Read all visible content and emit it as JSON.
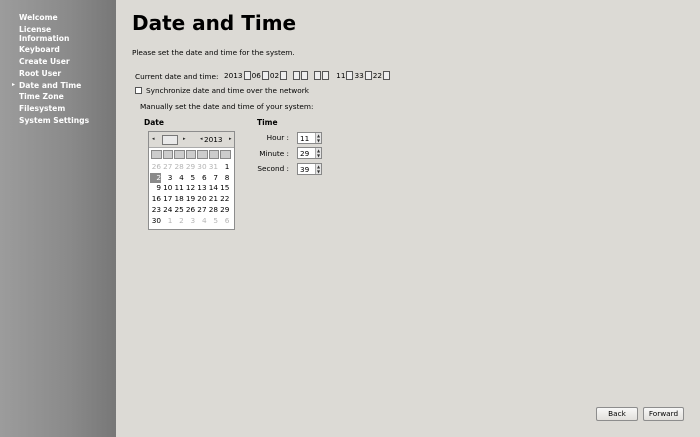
{
  "sidebar": {
    "items": [
      {
        "label": "Welcome"
      },
      {
        "label": "License"
      },
      {
        "label": "Information"
      },
      {
        "label": "Keyboard"
      },
      {
        "label": "Create User"
      },
      {
        "label": "Root User"
      },
      {
        "label": "Date and Time"
      },
      {
        "label": "Time Zone"
      },
      {
        "label": "Filesystem"
      },
      {
        "label": "System Settings"
      }
    ],
    "current_marker": "▸"
  },
  "page": {
    "title": "Date and Time",
    "intro": "Please set the date and time for the system."
  },
  "current": {
    "label": "Current date and time:",
    "year": "2013",
    "month": "06",
    "day": "02",
    "hour": "11",
    "minute": "33",
    "second": "22"
  },
  "sync": {
    "label": "Synchronize date and time over the network",
    "checked": false
  },
  "manual_label": "Manually set the date and time of your system:",
  "date_header": "Date",
  "time_header": "Time",
  "calendar": {
    "prev": "◂",
    "next": "▸",
    "year": "2013",
    "selected_day": "2",
    "weeks": [
      [
        "26",
        "27",
        "28",
        "29",
        "30",
        "31",
        "1"
      ],
      [
        "2",
        "3",
        "4",
        "5",
        "6",
        "7",
        "8"
      ],
      [
        "9",
        "10",
        "11",
        "12",
        "13",
        "14",
        "15"
      ],
      [
        "16",
        "17",
        "18",
        "19",
        "20",
        "21",
        "22"
      ],
      [
        "23",
        "24",
        "25",
        "26",
        "27",
        "28",
        "29"
      ],
      [
        "30",
        "1",
        "2",
        "3",
        "4",
        "5",
        "6"
      ]
    ]
  },
  "time": {
    "hour_label": "Hour :",
    "hour": "11",
    "minute_label": "Minute :",
    "minute": "29",
    "second_label": "Second :",
    "second": "39"
  },
  "buttons": {
    "back": "Back",
    "forward": "Forward"
  }
}
